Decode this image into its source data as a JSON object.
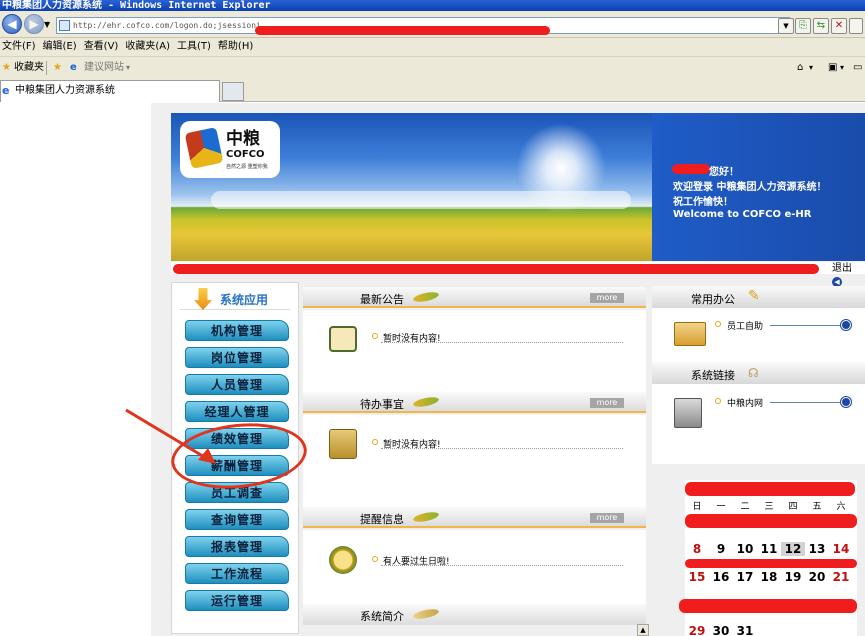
{
  "browser": {
    "title": "中粮集团人力资源系统 - Windows Internet Explorer",
    "url_prefix": "http://ehr.cofco.com/logon.do;jsessioni",
    "menu": [
      "文件(F)",
      "编辑(E)",
      "查看(V)",
      "收藏夹(A)",
      "工具(T)",
      "帮助(H)"
    ],
    "favorites_label": "收藏夹",
    "suggested_sites": "建议网站",
    "tab_title": "中粮集团人力资源系统"
  },
  "header": {
    "logo_cn": "中粮",
    "logo_en": "COFCO",
    "logo_slogan": "自然之源 重塑你我",
    "greeting": "您好！",
    "welcome_line": "欢迎登录 中粮集团人力资源系统！",
    "wish_line": "祝工作愉快！",
    "welcome_en": "Welcome to COFCO e-HR",
    "logout": "退出"
  },
  "sidebar": {
    "title": "系统应用",
    "items": [
      "机构管理",
      "岗位管理",
      "人员管理",
      "经理人管理",
      "绩效管理",
      "薪酬管理",
      "员工调查",
      "查询管理",
      "报表管理",
      "工作流程",
      "运行管理"
    ]
  },
  "panels": {
    "announcements": {
      "title": "最新公告",
      "more": "more",
      "item": "暂时没有内容!"
    },
    "todo": {
      "title": "待办事宜",
      "more": "more",
      "item": "暂时没有内容!"
    },
    "reminder": {
      "title": "提醒信息",
      "more": "more",
      "item": "有人要过生日啦!"
    },
    "intro": {
      "title": "系统简介"
    }
  },
  "right": {
    "office": {
      "title": "常用办公",
      "item": "员工自助"
    },
    "links": {
      "title": "系统链接",
      "item": "中粮内网"
    }
  },
  "calendar": {
    "weekdays": [
      "日",
      "一",
      "二",
      "三",
      "四",
      "五",
      "六"
    ],
    "row2": [
      "8",
      "9",
      "10",
      "11",
      "12",
      "13",
      "14"
    ],
    "row3": [
      "15",
      "16",
      "17",
      "18",
      "19",
      "20",
      "21"
    ],
    "row5": [
      "29",
      "30",
      "31"
    ],
    "today": "12"
  },
  "colors": {
    "accent": "#1f8fbf",
    "redaction": "#ef1d1d",
    "annotation": "#e0341f"
  }
}
